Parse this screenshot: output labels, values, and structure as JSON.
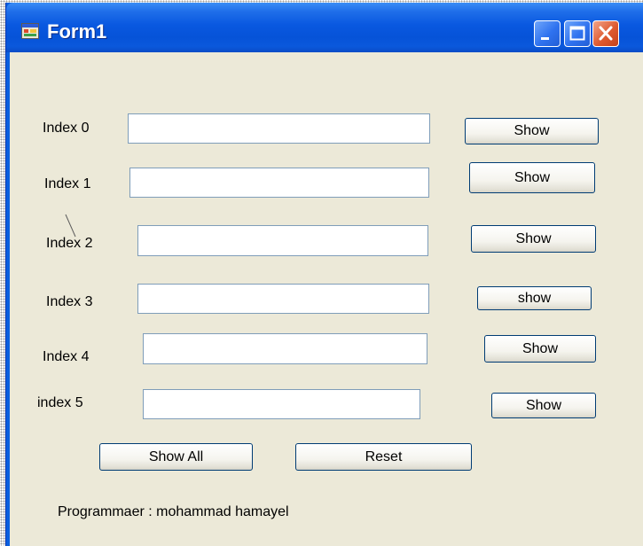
{
  "window": {
    "title": "Form1"
  },
  "rows": [
    {
      "label": "Index 0",
      "value": "",
      "button": "Show"
    },
    {
      "label": "Index 1",
      "value": "",
      "button": "Show"
    },
    {
      "label": "Index 2",
      "value": "",
      "button": "Show"
    },
    {
      "label": "Index 3",
      "value": "",
      "button": "show"
    },
    {
      "label": "Index 4",
      "value": "",
      "button": "Show"
    },
    {
      "label": "index 5",
      "value": "",
      "button": "Show"
    }
  ],
  "actions": {
    "show_all": "Show All",
    "reset": "Reset"
  },
  "footer": {
    "text": "Programmaer : mohammad hamayel"
  },
  "icons": {
    "app": "form-app-icon",
    "minimize": "minimize-icon",
    "maximize": "maximize-icon",
    "close": "close-icon"
  }
}
